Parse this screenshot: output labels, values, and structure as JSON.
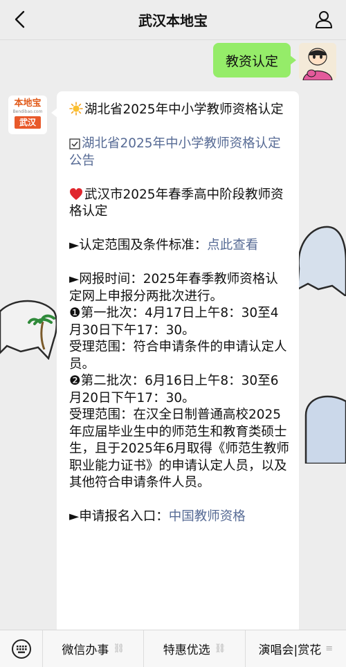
{
  "header": {
    "title": "武汉本地宝",
    "back_icon": "chevron-left-icon",
    "profile_icon": "person-icon"
  },
  "user_message": {
    "text": "教资认定"
  },
  "bot": {
    "logo_top": "本地宝",
    "logo_sub": "Bendibao.com",
    "logo_city": "武汉"
  },
  "bot_message": {
    "p1": "湖北省2025年中小学教师资格认定",
    "p2_link": "湖北省2025年中小学教师资格认定公告",
    "p3": "武汉市2025年春季高中阶段教师资格认定",
    "p4_label": "►认定范围及条件标准：",
    "p4_link": "点此查看",
    "p5_intro": "►网报时间：2025年春季教师资格认定网上申报分两批次进行。",
    "p5_batch1": "❶第一批次：4月17日上午8：30至4月30日下午17：30。",
    "p5_scope1": "受理范围：符合申请条件的申请认定人员。",
    "p5_batch2": "❷第二批次：6月16日上午8：30至6月20日下午17：30。",
    "p5_scope2": "受理范围：在汉全日制普通高校2025年应届毕业生中的师范生和教育类硕士生，且于2025年6月取得《师范生教师职业能力证书》的申请认定人员，以及其他符合申请条件人员。",
    "p6_label": "►申请报名入口：",
    "p6_link": "中国教师资格"
  },
  "bottom_menu": {
    "keyboard_icon": "keyboard-icon",
    "items": [
      {
        "label": "微信办事"
      },
      {
        "label": "特惠优选"
      },
      {
        "label": "演唱会|赏花"
      }
    ]
  },
  "colors": {
    "user_bubble": "#95ec69",
    "link": "#576b95",
    "background": "#ededed"
  }
}
